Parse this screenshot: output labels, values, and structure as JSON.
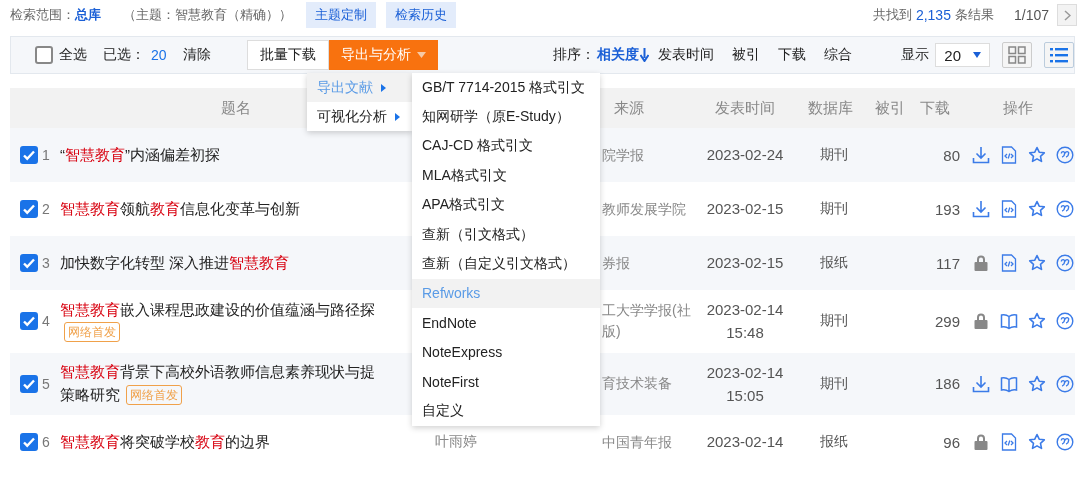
{
  "search_scope": {
    "label": "检索范围：",
    "value": "总库"
  },
  "query": "（主题：智慧教育（精确））",
  "top_buttons": [
    "主题定制",
    "检索历史"
  ],
  "results": {
    "prefix": "共找到",
    "count": "2,135",
    "suffix": "条结果",
    "page": "1/107"
  },
  "toolbar": {
    "select_all": {
      "label": "全选",
      "checked": false
    },
    "selected_label": "已选：",
    "selected_count": "20",
    "clear": "清除",
    "batch_download": "批量下载",
    "export_button": {
      "label": "导出与分析",
      "expanded": true
    },
    "sort_label": "排序：",
    "sort_options": [
      {
        "label": "相关度",
        "selected": true
      },
      {
        "label": "发表时间",
        "selected": false
      },
      {
        "label": "被引",
        "selected": false
      },
      {
        "label": "下载",
        "selected": false
      },
      {
        "label": "综合",
        "selected": false
      }
    ],
    "display_label": "显示",
    "page_size": "20",
    "views": [
      {
        "kind": "grid",
        "selected": false
      },
      {
        "kind": "list",
        "selected": true
      }
    ]
  },
  "table": {
    "columns": [
      "题名",
      "来源",
      "发表时间",
      "数据库",
      "被引",
      "下载",
      "操作"
    ],
    "rows": [
      {
        "checked": true,
        "index": "1",
        "title_lines": [
          [
            {
              "text": "“",
              "highlight": false
            },
            {
              "text": "智慧教育",
              "highlight": true
            },
            {
              "text": "”内涵偏差初探",
              "highlight": false
            }
          ]
        ],
        "source": [
          "院学报"
        ],
        "date": [
          "2023-02-24"
        ],
        "database": "期刊",
        "downloads": "80",
        "actions": [
          {
            "kind": "download"
          },
          {
            "kind": "html"
          },
          {
            "kind": "favorite"
          },
          {
            "kind": "cite"
          }
        ]
      },
      {
        "checked": true,
        "index": "2",
        "title_lines": [
          [
            {
              "text": "智慧教育",
              "highlight": true
            },
            {
              "text": "领航",
              "highlight": false
            },
            {
              "text": "教育",
              "highlight": true
            },
            {
              "text": "信息化变革与创新",
              "highlight": false
            }
          ]
        ],
        "source": [
          "教师发展学院"
        ],
        "date": [
          "2023-02-15"
        ],
        "database": "期刊",
        "downloads": "193",
        "actions": [
          {
            "kind": "download"
          },
          {
            "kind": "html"
          },
          {
            "kind": "favorite"
          },
          {
            "kind": "cite"
          }
        ]
      },
      {
        "checked": true,
        "index": "3",
        "title_lines": [
          [
            {
              "text": "加快数字化转型 深入推进",
              "highlight": false
            },
            {
              "text": "智慧教育",
              "highlight": true
            }
          ]
        ],
        "source": [
          "券报"
        ],
        "date": [
          "2023-02-15"
        ],
        "database": "报纸",
        "downloads": "117",
        "actions": [
          {
            "kind": "lock"
          },
          {
            "kind": "html"
          },
          {
            "kind": "favorite"
          },
          {
            "kind": "cite"
          }
        ]
      },
      {
        "checked": true,
        "index": "4",
        "title_lines": [
          [
            {
              "text": "智慧教育",
              "highlight": true
            },
            {
              "text": "嵌入课程思政建设的价值蕴涵与路径探",
              "highlight": false
            }
          ]
        ],
        "badge": "网络首发",
        "source": [
          "工大学学报(社",
          "版)"
        ],
        "date": [
          "2023-02-14",
          "15:48"
        ],
        "database": "期刊",
        "downloads": "299",
        "actions": [
          {
            "kind": "lock"
          },
          {
            "kind": "book"
          },
          {
            "kind": "favorite"
          },
          {
            "kind": "cite"
          }
        ]
      },
      {
        "checked": true,
        "index": "5",
        "title_lines": [
          [
            {
              "text": "智慧教育",
              "highlight": true
            },
            {
              "text": "背景下高校外语教师信息素养现状与提",
              "highlight": false
            }
          ],
          [
            {
              "text": "策略研究",
              "highlight": false
            }
          ]
        ],
        "badge": "网络首发",
        "source": [
          "育技术装备"
        ],
        "date": [
          "2023-02-14",
          "15:05"
        ],
        "database": "期刊",
        "downloads": "186",
        "actions": [
          {
            "kind": "download"
          },
          {
            "kind": "book"
          },
          {
            "kind": "favorite"
          },
          {
            "kind": "cite"
          }
        ]
      },
      {
        "checked": true,
        "index": "6",
        "title_lines": [
          [
            {
              "text": "智慧教育",
              "highlight": true
            },
            {
              "text": "将突破学校",
              "highlight": false
            },
            {
              "text": "教育",
              "highlight": true
            },
            {
              "text": "的边界",
              "highlight": false
            }
          ]
        ],
        "author": "叶雨婷",
        "source": [
          "中国青年报"
        ],
        "date": [
          "2023-02-14"
        ],
        "database": "报纸",
        "downloads": "96",
        "actions": [
          {
            "kind": "lock"
          },
          {
            "kind": "html"
          },
          {
            "kind": "favorite"
          },
          {
            "kind": "cite"
          }
        ]
      }
    ]
  },
  "export_menu": [
    {
      "label": "导出文献",
      "selected": true
    },
    {
      "label": "可视化分析",
      "selected": false
    }
  ],
  "export_submenu": [
    {
      "label": "GB/T 7714-2015 格式引文",
      "selected": false
    },
    {
      "label": "知网研学（原E-Study）",
      "selected": false
    },
    {
      "label": "CAJ-CD 格式引文",
      "selected": false
    },
    {
      "label": "MLA格式引文",
      "selected": false
    },
    {
      "label": "APA格式引文",
      "selected": false
    },
    {
      "label": "查新（引文格式）",
      "selected": false
    },
    {
      "label": "查新（自定义引文格式）",
      "selected": false
    },
    {
      "label": "Refworks",
      "selected": true
    },
    {
      "label": "EndNote",
      "selected": false
    },
    {
      "label": "NoteExpress",
      "selected": false
    },
    {
      "label": "NoteFirst",
      "selected": false
    },
    {
      "label": "自定义",
      "selected": false
    }
  ]
}
